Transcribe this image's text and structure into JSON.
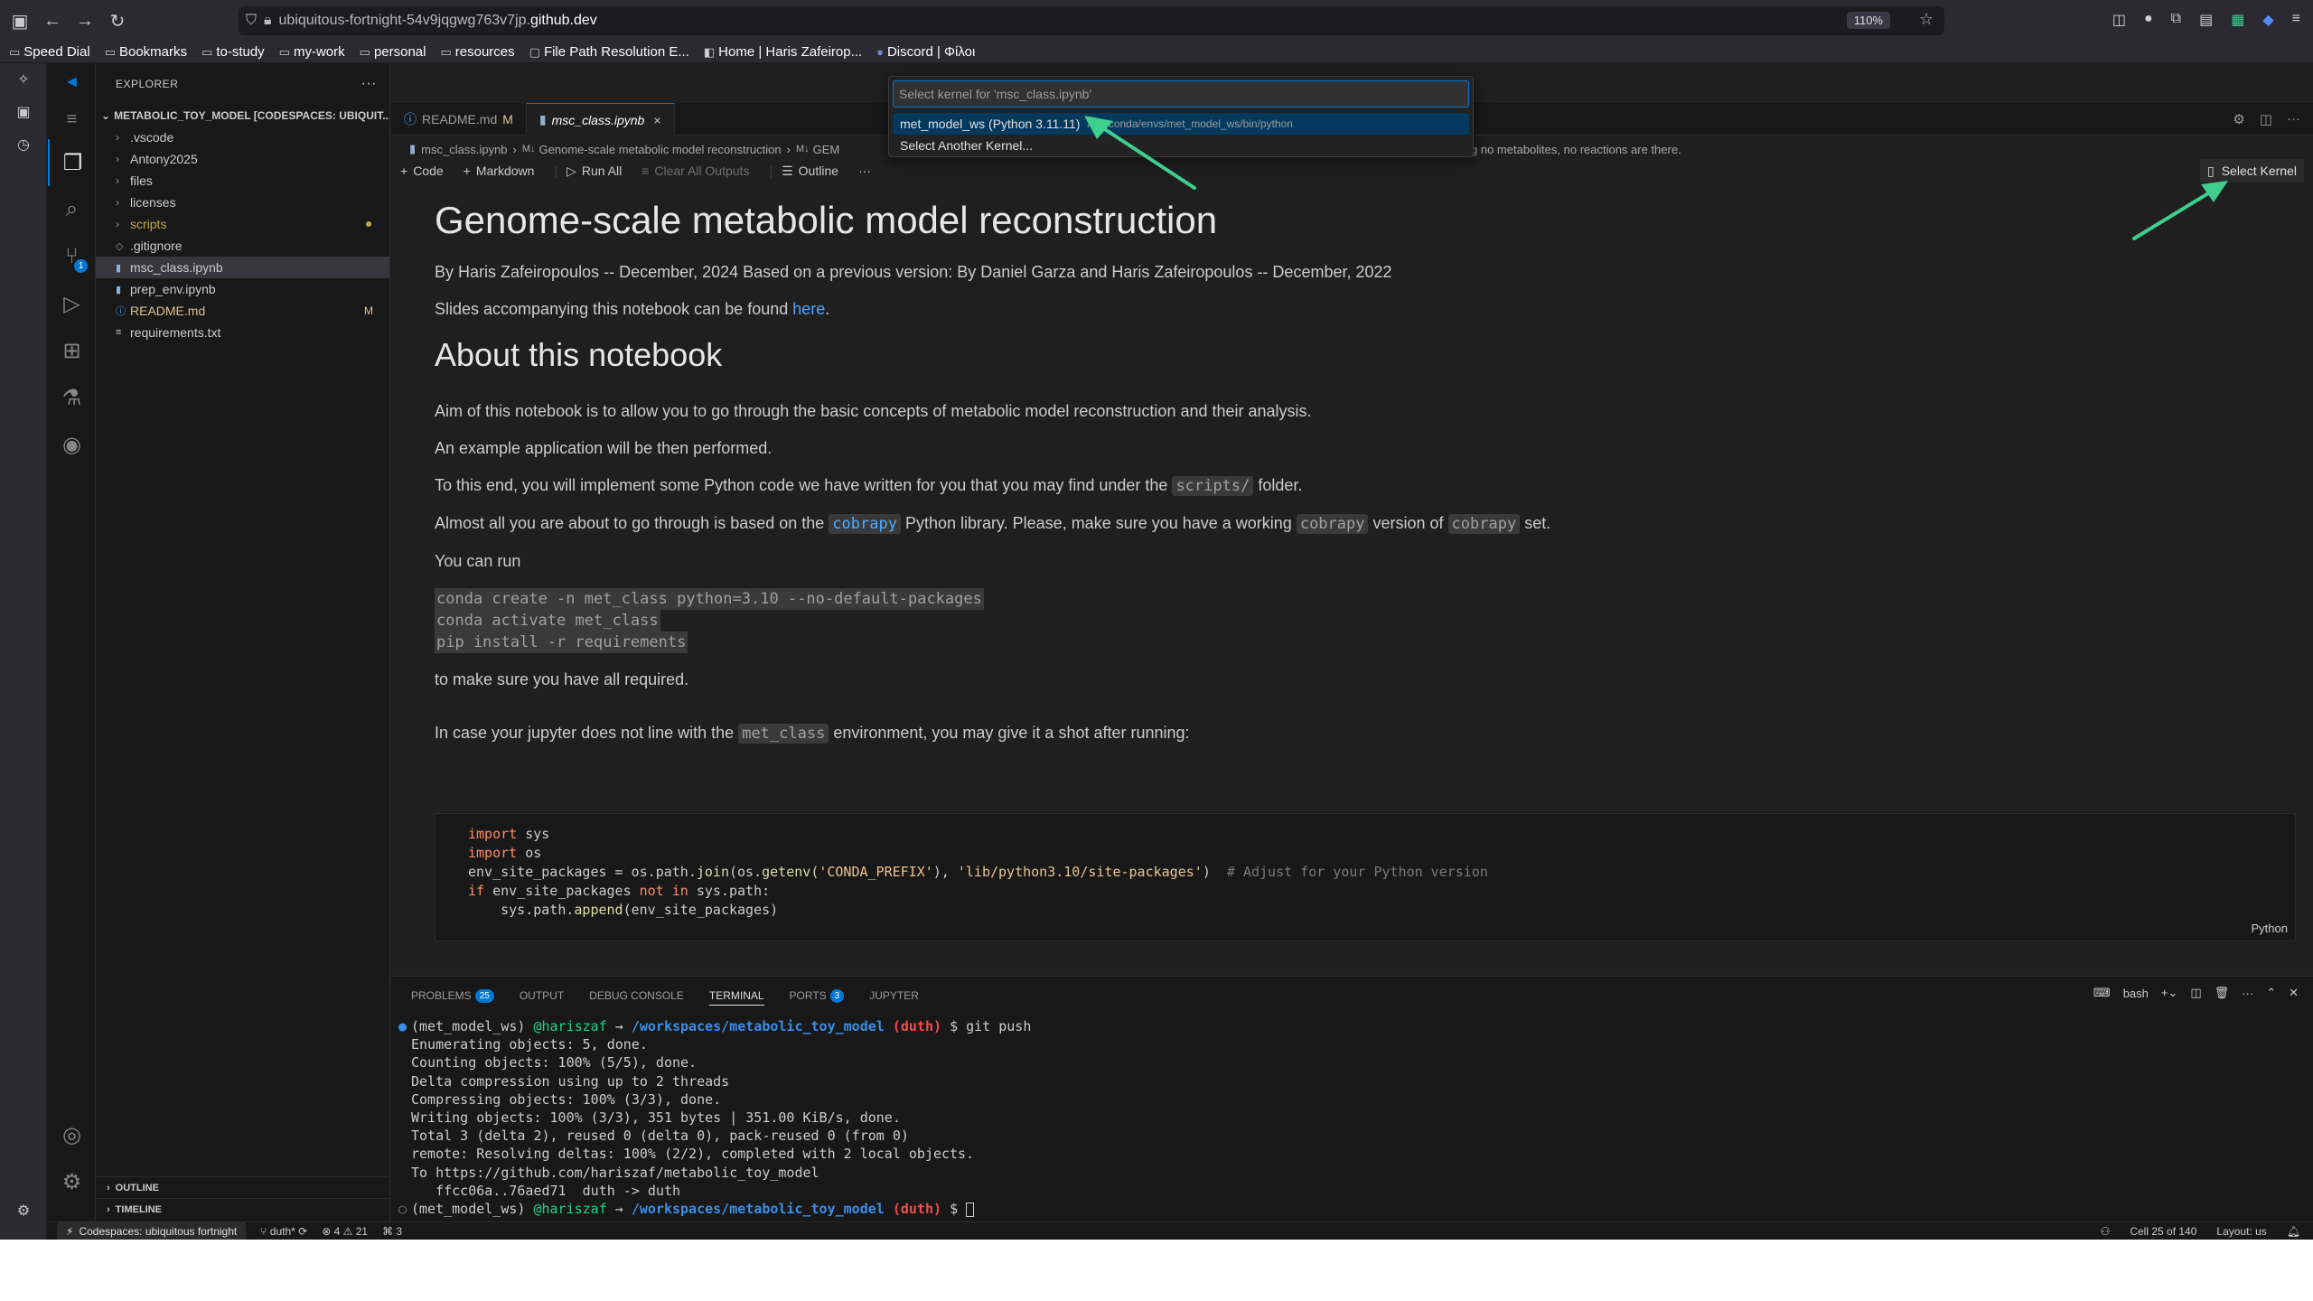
{
  "browser": {
    "url_prefix": "ubiquitous-fortnight-54v9jqgwg763v7jp.",
    "url_host": "github.dev",
    "zoom": "110%"
  },
  "bookmarks": [
    "Speed Dial",
    "Bookmarks",
    "to-study",
    "my-work",
    "personal",
    "resources",
    "File Path Resolution E...",
    "Home | Haris Zafeirop...",
    "Discord | Φίλοι"
  ],
  "explorer": {
    "title": "EXPLORER",
    "root": "METABOLIC_TOY_MODEL [CODESPACES: UBIQUIT...",
    "items": [
      {
        "label": ".vscode",
        "kind": "folder"
      },
      {
        "label": "Antony2025",
        "kind": "folder"
      },
      {
        "label": "files",
        "kind": "folder"
      },
      {
        "label": "licenses",
        "kind": "folder"
      },
      {
        "label": "scripts",
        "kind": "folder"
      },
      {
        "label": ".gitignore",
        "kind": "file"
      },
      {
        "label": "msc_class.ipynb",
        "kind": "file"
      },
      {
        "label": "prep_env.ipynb",
        "kind": "file"
      },
      {
        "label": "README.md",
        "kind": "file",
        "mark": "M"
      },
      {
        "label": "requirements.txt",
        "kind": "file"
      }
    ],
    "outline": "OUTLINE",
    "timeline": "TIMELINE"
  },
  "tabs": [
    {
      "label": "README.md",
      "mark": "M"
    },
    {
      "label": "msc_class.ipynb",
      "close": "×"
    }
  ],
  "breadcrumbs": {
    "file": "msc_class.ipynb",
    "section": "Genome-scale metabolic model reconstruction",
    "tail": "GEM",
    "behind": "g no metabolites, no reactions are there."
  },
  "toolbar": {
    "code": "Code",
    "markdown": "Markdown",
    "run_all": "Run All",
    "clear_outputs": "Clear All Outputs",
    "outline": "Outline",
    "more": "···",
    "select_kernel": "Select Kernel"
  },
  "quickpick": {
    "placeholder": "Select kernel for 'msc_class.ipynb'",
    "items": [
      {
        "label": "met_model_ws (Python 3.11.11)",
        "desc": "/opt/conda/envs/met_model_ws/bin/python"
      },
      {
        "label": "Select Another Kernel...",
        "desc": ""
      }
    ]
  },
  "notebook": {
    "h1": "Genome-scale metabolic model reconstruction",
    "byline": "By Haris Zafeiropoulos -- December, 2024 Based on a previous version: By Daniel Garza and Haris Zafeiropoulos -- December, 2022",
    "slides_pre": "Slides accompanying this notebook can be found ",
    "slides_link": "here",
    "slides_post": ".",
    "h2": "About this notebook",
    "p_aim": "Aim of this notebook is to allow you to go through the basic concepts of metabolic model reconstruction and their analysis.",
    "p_example": "An example application will be then performed.",
    "p_end_pre": "To this end, you will implement some Python code we have written for you that you may find under the ",
    "p_end_code": "scripts/",
    "p_end_post": " folder.",
    "p_almost_1": "Almost all you are about to go through is based on the ",
    "p_almost_code1": "cobrapy",
    "p_almost_2": " Python library. Please, make sure you have a working ",
    "p_almost_code2": "cobrapy",
    "p_almost_3": " version of ",
    "p_almost_code3": "cobrapy",
    "p_almost_4": " set.",
    "p_run": "You can run",
    "cmd1": "conda create -n met_class python=3.10 --no-default-packages",
    "cmd2": "conda activate met_class",
    "cmd3": "pip install -r requirements",
    "p_required": "to make sure you have all required.",
    "p_case_pre": "In case your jupyter does not line with the ",
    "p_case_code": "met_class",
    "p_case_post": " environment, you may give it a shot after running:",
    "cell_lang": "Python",
    "code": {
      "l1_kw": "import",
      "l1_rest": " sys",
      "l2_kw": "import",
      "l2_rest": " os",
      "l3_a": "env_site_packages = os.path.",
      "l3_fn1": "join",
      "l3_b": "(os.",
      "l3_fn2": "getenv",
      "l3_c": "(",
      "l3_s1": "'CONDA_PREFIX'",
      "l3_d": "), ",
      "l3_s2": "'lib/python3.10/site-packages'",
      "l3_e": ")  ",
      "l3_cm": "# Adjust for your Python version",
      "l4_kw": "if",
      "l4_a": " env_site_packages ",
      "l4_kw2": "not in",
      "l4_b": " sys.path:",
      "l5_a": "    sys.path.",
      "l5_fn": "append",
      "l5_b": "(env_site_packages)"
    }
  },
  "panel": {
    "tabs": [
      {
        "label": "PROBLEMS",
        "badge": "25"
      },
      {
        "label": "OUTPUT"
      },
      {
        "label": "DEBUG CONSOLE"
      },
      {
        "label": "TERMINAL"
      },
      {
        "label": "PORTS",
        "badge": "3"
      },
      {
        "label": "JUPYTER"
      }
    ],
    "shell": "bash"
  },
  "terminal": {
    "env": "(met_model_ws)",
    "user": "@hariszaf",
    "arrow": "→",
    "path": "/workspaces/metabolic_toy_model",
    "branch": "(duth)",
    "cmd": "$ git push",
    "lines": [
      "Enumerating objects: 5, done.",
      "Counting objects: 100% (5/5), done.",
      "Delta compression using up to 2 threads",
      "Compressing objects: 100% (3/3), done.",
      "Writing objects: 100% (3/3), 351 bytes | 351.00 KiB/s, done.",
      "Total 3 (delta 2), reused 0 (delta 0), pack-reused 0 (from 0)",
      "remote: Resolving deltas: 100% (2/2), completed with 2 local objects.",
      "To https://github.com/hariszaf/metabolic_toy_model",
      "   ffcc06a..76aed71  duth -> duth"
    ],
    "prompt_end": "$"
  },
  "status": {
    "remote": "Codespaces: ubiquitous fortnight",
    "branch": "duth*",
    "errors": "⊗ 4",
    "warnings": "⚠ 21",
    "ports": "3",
    "cell": "Cell 25 of 140",
    "layout": "Layout: us"
  },
  "colors": {
    "accent": "#0078d4",
    "arrow": "#3ecf8e",
    "link": "#4daafc"
  }
}
